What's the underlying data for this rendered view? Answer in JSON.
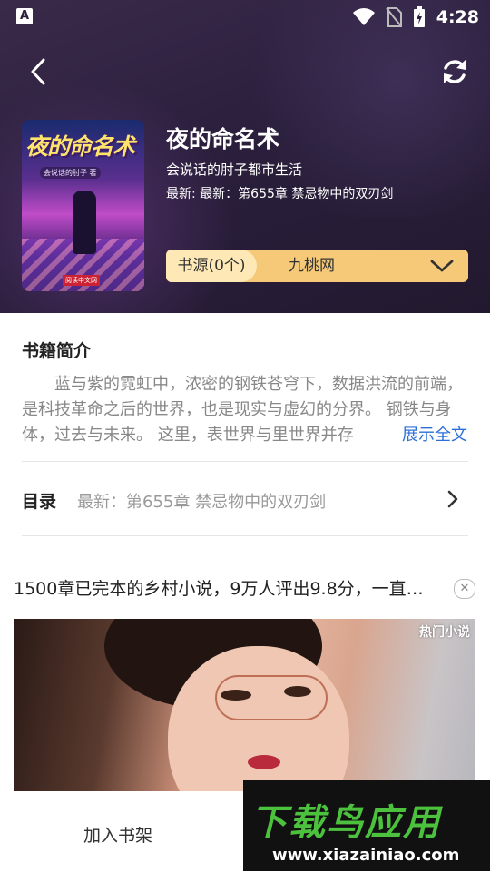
{
  "status_bar": {
    "left_icon": "A",
    "time": "4:28"
  },
  "header": {
    "back_icon": "back-arrow-icon",
    "refresh_icon": "refresh-icon"
  },
  "book": {
    "cover_title": "夜的命名术",
    "cover_subtitle": "会说话的肘子 著",
    "cover_publisher": "阅读中文网",
    "title": "夜的命名术",
    "author_category": "会说话的肘子都市生活",
    "latest": "最新: 最新：第655章 禁忌物中的双刃剑"
  },
  "source": {
    "label": "书源(0个)",
    "value": "九桃网"
  },
  "intro": {
    "heading": "书籍简介",
    "text": "蓝与紫的霓虹中，浓密的钢铁苍穹下，数据洪流的前端，是科技革命之后的世界，也是现实与虚幻的分界。 钢铁与身体，过去与未来。 这里，表世界与里世界并存",
    "show_all": "展示全文"
  },
  "toc": {
    "label": "目录",
    "latest": "最新：第655章 禁忌物中的双刃剑"
  },
  "ad": {
    "title": "1500章已完本的乡村小说，9万人评出9.8分，一直…",
    "close": "✕",
    "tag": "热门小说"
  },
  "bottom": {
    "add_shelf": "加入书架"
  },
  "watermark": {
    "brand": "下载鸟应用",
    "url": "www.xiazainiao.com"
  },
  "colors": {
    "hero_bg": "#2b1f3d",
    "source_bg": "#f6c978",
    "link": "#2d6fd6",
    "watermark_green": "#4cc13d"
  }
}
